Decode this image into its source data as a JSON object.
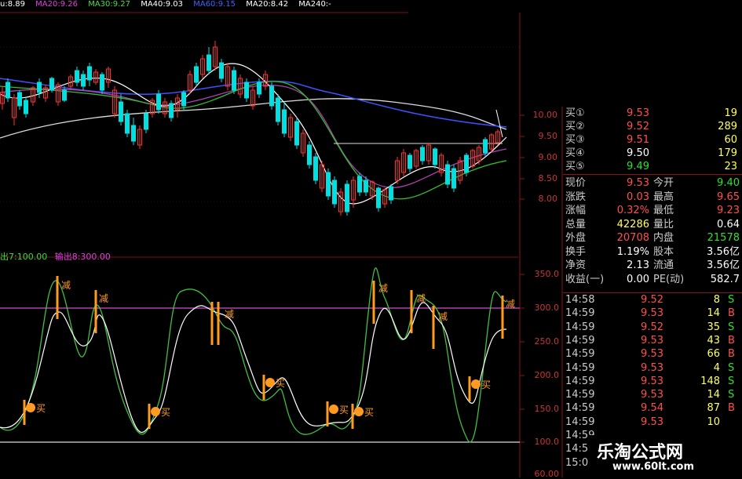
{
  "ma_bar": {
    "items": [
      {
        "label": "u:8.89",
        "color": "#ffffff"
      },
      {
        "label": "MA20:9.26",
        "color": "#e040e0"
      },
      {
        "label": "MA30:9.27",
        "color": "#40e040"
      },
      {
        "label": "MA40:9.03",
        "color": "#ffffff"
      },
      {
        "label": "MA60:9.15",
        "color": "#4060ff"
      },
      {
        "label": "MA20:8.42",
        "color": "#ffffff"
      },
      {
        "label": "MA240:-",
        "color": "#ffffff"
      }
    ]
  },
  "indicator_bar": {
    "out7": "出7:100.00",
    "out8": "输出8:300.00"
  },
  "price_axis": [
    "10.00",
    "9.50",
    "9.00",
    "8.50",
    "8.00"
  ],
  "ind_axis": [
    "350.0",
    "300.0",
    "250.0",
    "200.0",
    "150.0",
    "100.0",
    "60.00"
  ],
  "signals": {
    "sell": "减",
    "buy": "买"
  },
  "orders": [
    {
      "label": "买①",
      "price": "9.53",
      "vol": "19"
    },
    {
      "label": "买②",
      "price": "9.52",
      "vol": "289"
    },
    {
      "label": "买③",
      "price": "9.51",
      "vol": "60"
    },
    {
      "label": "买④",
      "price": "9.50",
      "vol": "179"
    },
    {
      "label": "买⑤",
      "price": "9.49",
      "vol": "23"
    }
  ],
  "stats": [
    {
      "l1": "现价",
      "v1": "9.53",
      "l2": "今开",
      "v2": "9.40"
    },
    {
      "l1": "涨跌",
      "v1": "0.03",
      "l2": "最高",
      "v2": "9.65"
    },
    {
      "l1": "涨幅",
      "v1": "0.32%",
      "l2": "最低",
      "v2": "9.23"
    },
    {
      "l1": "总量",
      "v1": "42286",
      "l2": "量比",
      "v2": "0.64"
    },
    {
      "l1": "外盘",
      "v1": "20708",
      "l2": "内盘",
      "v2": "21578"
    },
    {
      "l1": "换手",
      "v1": "1.19%",
      "l2": "股本",
      "v2": "3.56亿"
    },
    {
      "l1": "净资",
      "v1": "2.13",
      "l2": "流通",
      "v2": "3.56亿"
    },
    {
      "l1": "收益(一)",
      "v1": "0.00",
      "l2": "PE(动)",
      "v2": "582.7"
    }
  ],
  "ticks": [
    {
      "time": "14:58",
      "price": "9.52",
      "vol": "8",
      "side": "S"
    },
    {
      "time": "14:59",
      "price": "9.53",
      "vol": "14",
      "side": "B"
    },
    {
      "time": "14:59",
      "price": "9.52",
      "vol": "35",
      "side": "S"
    },
    {
      "time": "14:59",
      "price": "9.53",
      "vol": "43",
      "side": "B"
    },
    {
      "time": "14:59",
      "price": "9.53",
      "vol": "66",
      "side": "B"
    },
    {
      "time": "14:59",
      "price": "9.53",
      "vol": "4",
      "side": "S"
    },
    {
      "time": "14:59",
      "price": "9.53",
      "vol": "148",
      "side": "S"
    },
    {
      "time": "14:59",
      "price": "9.53",
      "vol": "14",
      "side": "S"
    },
    {
      "time": "14:59",
      "price": "9.54",
      "vol": "87",
      "side": "B"
    },
    {
      "time": "14:59",
      "price": "9.53",
      "vol": "10",
      "side": ""
    },
    {
      "time": "14:59",
      "price": "",
      "vol": "",
      "side": ""
    },
    {
      "time": "14:59",
      "price": "",
      "vol": "",
      "side": ""
    },
    {
      "time": "15:00",
      "price": "",
      "vol": "",
      "side": ""
    }
  ],
  "watermark": {
    "title": "乐淘公式网",
    "url": "www.60lt.com"
  },
  "colors": {
    "up": "#ff3030",
    "down": "#00e0e0",
    "red": "#ff5050",
    "green": "#30e030",
    "signal": "#ff9b20",
    "grid": "#7a1010",
    "purple_line": "#b040b0"
  }
}
